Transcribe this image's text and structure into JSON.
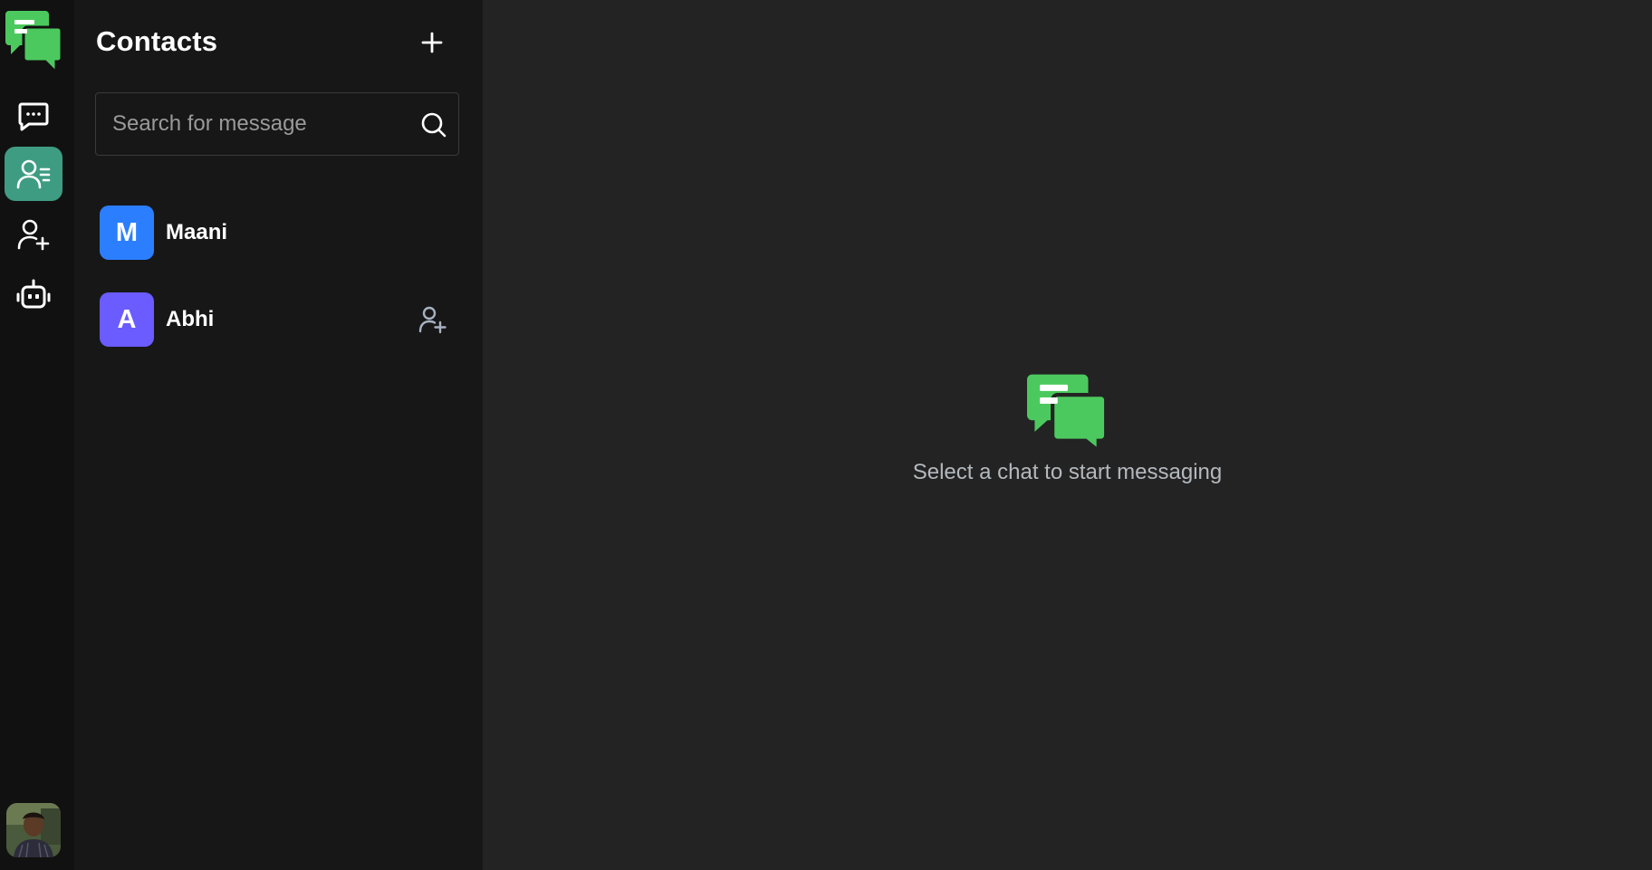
{
  "rail": {
    "items": [
      {
        "name": "chats",
        "icon": "chat-dots-icon"
      },
      {
        "name": "contacts",
        "icon": "contacts-list-icon",
        "active": true
      },
      {
        "name": "add-user",
        "icon": "user-plus-icon"
      },
      {
        "name": "bot",
        "icon": "robot-icon"
      }
    ],
    "accent": "#3e9c82"
  },
  "contacts": {
    "title": "Contacts",
    "search_placeholder": "Search for message",
    "list": [
      {
        "initial": "M",
        "name": "Maani",
        "color": "#2b7fff"
      },
      {
        "initial": "A",
        "name": "Abhi",
        "color": "#6a5cff"
      }
    ]
  },
  "main": {
    "empty_message": "Select a chat to start messaging"
  },
  "brand": {
    "green": "#4cc95e"
  }
}
